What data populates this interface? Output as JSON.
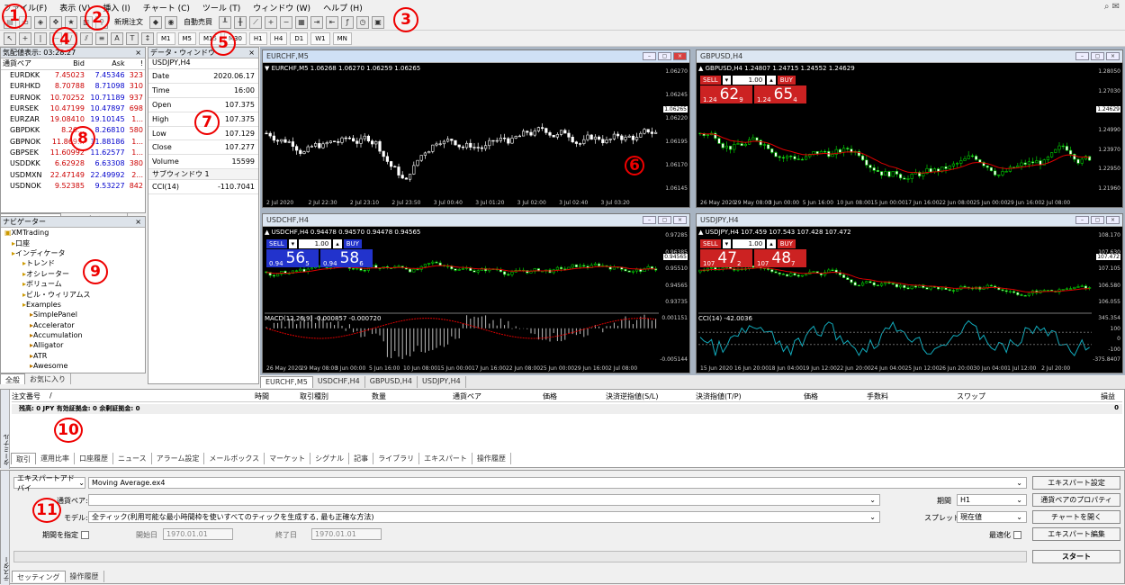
{
  "menu": [
    "ファイル(F)",
    "表示 (V)",
    "挿入 (I)",
    "チャート (C)",
    "ツール (T)",
    "ウィンドウ (W)",
    "ヘルプ (H)"
  ],
  "toolbar": {
    "new_order": "新規注文",
    "auto_trade": "自動売買"
  },
  "timeframes": [
    "M1",
    "M5",
    "M15",
    "M30",
    "H1",
    "H4",
    "D1",
    "W1",
    "MN"
  ],
  "markers": [
    "1",
    "2",
    "3",
    "4",
    "5",
    "6",
    "7",
    "8",
    "9",
    "10",
    "11"
  ],
  "market_watch": {
    "title": "気配値表示: 03:28:27",
    "cols": [
      "通貨ペア",
      "Bid",
      "Ask",
      "!"
    ],
    "rows": [
      [
        "EURDKK",
        "7.45023",
        "7.45346",
        "323"
      ],
      [
        "EURHKD",
        "8.70788",
        "8.71098",
        "310"
      ],
      [
        "EURNOK",
        "10.70252",
        "10.71189",
        "937"
      ],
      [
        "EURSEK",
        "10.47199",
        "10.47897",
        "698"
      ],
      [
        "EURZAR",
        "19.08410",
        "19.10145",
        "1..."
      ],
      [
        "GBPDKK",
        "8.26…",
        "8.26810",
        "580"
      ],
      [
        "GBPNOK",
        "11.869…",
        "11.88186",
        "1..."
      ],
      [
        "GBPSEK",
        "11.60992",
        "11.62577",
        "1..."
      ],
      [
        "USDDKK",
        "6.62928",
        "6.63308",
        "380"
      ],
      [
        "USDMXN",
        "22.47149",
        "22.49992",
        "2..."
      ],
      [
        "USDNOK",
        "9.52385",
        "9.53227",
        "842"
      ]
    ],
    "tabs": [
      "通貨ペアリスト",
      "ティックチャート"
    ]
  },
  "data_window": {
    "title": "データ・ウィンドウ",
    "symbol": "USDJPY,H4",
    "rows": [
      [
        "Date",
        "2020.06.17"
      ],
      [
        "Time",
        "16:00"
      ],
      [
        "Open",
        "107.375"
      ],
      [
        "High",
        "107.375"
      ],
      [
        "Low",
        "107.129"
      ],
      [
        "Close",
        "107.277"
      ],
      [
        "Volume",
        "15599"
      ]
    ],
    "sub_title": "サブウィンドウ 1",
    "sub_rows": [
      [
        "CCI(14)",
        "-110.7041"
      ]
    ]
  },
  "navigator": {
    "title": "ナビゲーター",
    "items": [
      "XMTrading",
      "口座",
      "インディケータ",
      "トレンド",
      "オシレーター",
      "ボリューム",
      "ビル・ウィリアムス",
      "Examples",
      "SimplePanel",
      "Accelerator",
      "Accumulation",
      "Alligator",
      "ATR",
      "Awesome"
    ],
    "tabs": [
      "全般",
      "お気に入り"
    ]
  },
  "charts": [
    {
      "title": "EURCHF,M5",
      "ticker": "▼ EURCHF,M5  1.06268 1.06270 1.06259 1.06265",
      "prices": [
        "1.06270",
        "1.06245",
        "1.06220",
        "1.06195",
        "1.06170",
        "1.06145"
      ],
      "current": "1.06265",
      "times": [
        "2 Jul 2020",
        "2 Jul 22:30",
        "2 Jul 23:10",
        "2 Jul 23:50",
        "3 Jul 00:40",
        "3 Jul 01:20",
        "3 Jul 02:00",
        "3 Jul 02:40",
        "3 Jul 03:20"
      ]
    },
    {
      "title": "GBPUSD,H4",
      "ticker": "▲ GBPUSD,H4  1.24807 1.24715 1.24552 1.24629",
      "prices": [
        "1.28050",
        "1.27030",
        "1.26010",
        "1.24990",
        "1.23970",
        "1.22950",
        "1.21960"
      ],
      "current": "1.24629",
      "times": [
        "26 May 2020",
        "29 May 08:00",
        "3 Jun 00:00",
        "5 Jun 16:00",
        "10 Jun 08:00",
        "15 Jun 00:00",
        "17 Jun 16:00",
        "22 Jun 08:00",
        "25 Jun 00:00",
        "29 Jun 16:00",
        "2 Jul 08:00"
      ],
      "trade": {
        "sell": "SELL",
        "buy": "BUY",
        "lot": "1.00",
        "sell_big": "62",
        "sell_sup": "9",
        "sell_pre": "1.24",
        "buy_big": "65",
        "buy_sup": "4",
        "buy_pre": "1.24"
      }
    },
    {
      "title": "USDCHF,H4",
      "ticker": "▲ USDCHF,H4  0.94478 0.94570 0.94478 0.94565",
      "prices": [
        "0.97285",
        "0.96385",
        "0.95510",
        "0.94565",
        "0.93735"
      ],
      "current": "0.94565",
      "macd_label": "MACD(12,26,9) -0.000857 -0.000720",
      "macd_prices": [
        "0.001151",
        "-0.005144"
      ],
      "times": [
        "26 May 2020",
        "29 May 08:00",
        "3 Jun 00:00",
        "5 Jun 16:00",
        "10 Jun 08:00",
        "15 Jun 00:00",
        "17 Jun 16:00",
        "22 Jun 08:00",
        "25 Jun 00:00",
        "29 Jun 16:00",
        "2 Jul 08:00"
      ],
      "trade": {
        "sell": "SELL",
        "buy": "BUY",
        "lot": "1.00",
        "sell_big": "56",
        "sell_sup": "5",
        "sell_pre": "0.94",
        "buy_big": "58",
        "buy_sup": "6",
        "buy_pre": "0.94"
      }
    },
    {
      "title": "USDJPY,H4",
      "ticker": "▲ USDJPY,H4  107.459 107.543 107.428 107.472",
      "prices": [
        "108.170",
        "107.630",
        "107.105",
        "106.580",
        "106.055"
      ],
      "current": "107.472",
      "cci_label": "CCI(14) -42.0036",
      "cci_prices": [
        "345.354",
        "100",
        "0",
        "-100",
        "-375.8407"
      ],
      "times": [
        "15 Jun 2020",
        "16 Jun 20:00",
        "18 Jun 04:00",
        "19 Jun 12:00",
        "22 Jun 20:00",
        "24 Jun 04:00",
        "25 Jun 12:00",
        "26 Jun 20:00",
        "30 Jun 04:00",
        "1 Jul 12:00",
        "2 Jul 20:00"
      ],
      "trade": {
        "sell": "SELL",
        "buy": "BUY",
        "lot": "1.00",
        "sell_big": "47",
        "sell_sup": "2",
        "sell_pre": "107",
        "buy_big": "48",
        "buy_sup": "7",
        "buy_pre": "107"
      }
    }
  ],
  "chart_tabs": [
    "EURCHF,M5",
    "USDCHF,H4",
    "GBPUSD,H4",
    "USDJPY,H4"
  ],
  "terminal": {
    "cols": [
      "注文番号",
      "/",
      "時間",
      "取引種別",
      "数量",
      "通貨ペア",
      "価格",
      "決済逆指値(S/L)",
      "決済指値(T/P)",
      "価格",
      "手数料",
      "スワップ",
      "損益"
    ],
    "balance": "残高: 0 JPY  有効証拠金: 0  余剰証拠金: 0",
    "balance_val": "0",
    "tabs": [
      "取引",
      "運用比率",
      "口座履歴",
      "ニュース",
      "アラーム設定",
      "メールボックス",
      "マーケット",
      "シグナル",
      "記事",
      "ライブラリ",
      "エキスパート",
      "操作履歴"
    ],
    "side_label": "ターミナル"
  },
  "tester": {
    "type": "エキスパートアドバイ",
    "ea": "Moving Average.ex4",
    "pair_label": "通貨ペア:",
    "model_label": "モデル:",
    "model": "全ティック(利用可能な最小時間枠を使いすべてのティックを生成する, 最も正確な方法)",
    "period_use": "期間を指定",
    "start_label": "開始日",
    "start": "1970.01.01",
    "end_label": "終了日",
    "end": "1970.01.01",
    "period_label": "期間",
    "period": "H1",
    "spread_label": "スプレッド",
    "spread": "現在値",
    "optimize": "最適化",
    "btn_ea": "エキスパート設定",
    "btn_pair": "通貨ペアのプロパティ",
    "btn_chart": "チャートを開く",
    "btn_edit": "エキスパート編集",
    "btn_start": "スタート",
    "tabs": [
      "セッティング",
      "操作履歴"
    ],
    "side_label": "テスター"
  }
}
